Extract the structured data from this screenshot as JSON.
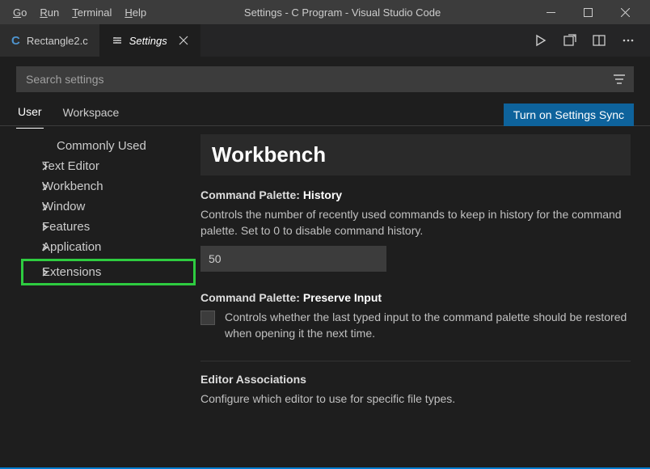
{
  "menu": {
    "go": "Go",
    "run": "Run",
    "terminal": "Terminal",
    "help": "Help"
  },
  "window_title": "Settings - C Program - Visual Studio Code",
  "tabs": {
    "file": "Rectangle2.c",
    "settings": "Settings"
  },
  "search": {
    "placeholder": "Search settings"
  },
  "scope": {
    "user": "User",
    "workspace": "Workspace",
    "sync": "Turn on Settings Sync"
  },
  "toc": {
    "commonly": "Commonly Used",
    "textEditor": "Text Editor",
    "workbench": "Workbench",
    "window": "Window",
    "features": "Features",
    "application": "Application",
    "extensions": "Extensions"
  },
  "content": {
    "header": "Workbench",
    "history": {
      "title_key": "Command Palette: ",
      "title_sub": "History",
      "desc": "Controls the number of recently used commands to keep in history for the command palette. Set to 0 to disable command history.",
      "value": "50"
    },
    "preserve": {
      "title_key": "Command Palette: ",
      "title_sub": "Preserve Input",
      "desc": "Controls whether the last typed input to the command palette should be restored when opening it the next time."
    },
    "assoc": {
      "title": "Editor Associations",
      "desc": "Configure which editor to use for specific file types."
    }
  }
}
